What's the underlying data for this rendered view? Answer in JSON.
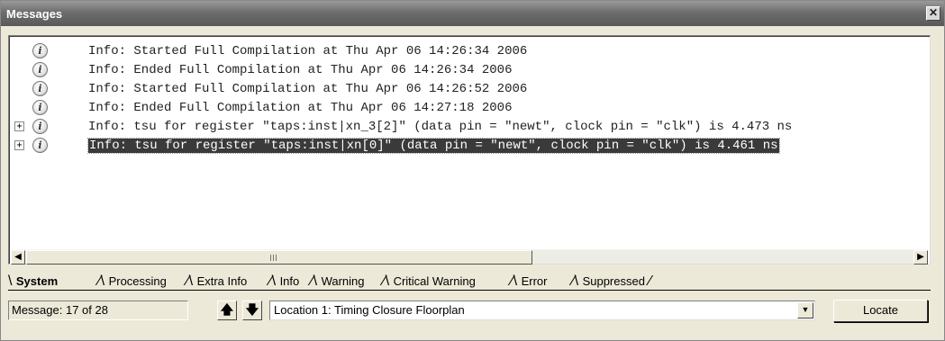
{
  "window": {
    "title": "Messages",
    "close_glyph": "✕"
  },
  "messages": [
    {
      "text": "Info: Started Full Compilation at Thu Apr 06 14:26:34 2006",
      "expandable": false,
      "selected": false
    },
    {
      "text": "Info: Ended Full Compilation at Thu Apr 06 14:26:34 2006",
      "expandable": false,
      "selected": false
    },
    {
      "text": "Info: Started Full Compilation at Thu Apr 06 14:26:52 2006",
      "expandable": false,
      "selected": false
    },
    {
      "text": "Info: Ended Full Compilation at Thu Apr 06 14:27:18 2006",
      "expandable": false,
      "selected": false
    },
    {
      "text": "Info: tsu for register \"taps:inst|xn_3[2]\" (data pin = \"newt\", clock pin = \"clk\") is 4.473 ns",
      "expandable": true,
      "selected": false
    },
    {
      "text": "Info: tsu for register \"taps:inst|xn[0]\" (data pin = \"newt\", clock pin = \"clk\") is 4.461 ns",
      "expandable": true,
      "selected": true
    }
  ],
  "icons": {
    "info": "info-icon",
    "expand": "expand-icon",
    "scroll_left": "scroll-left-icon",
    "scroll_right": "scroll-right-icon",
    "up": "arrow-up-icon",
    "down": "arrow-down-icon",
    "dropdown": "chevron-down-icon"
  },
  "tabs": [
    {
      "label": "System",
      "active": true
    },
    {
      "label": "Processing",
      "active": false
    },
    {
      "label": "Extra Info",
      "active": false
    },
    {
      "label": "Info",
      "active": false
    },
    {
      "label": "Warning",
      "active": false
    },
    {
      "label": "Critical Warning",
      "active": false
    },
    {
      "label": "Error",
      "active": false
    },
    {
      "label": "Suppressed",
      "active": false
    }
  ],
  "status": {
    "message_counter": "Message: 17 of 28"
  },
  "location": {
    "selected": "Location 1: Timing Closure Floorplan"
  },
  "buttons": {
    "locate": "Locate"
  },
  "colors": {
    "titlebar": "#6d6d6d",
    "selection": "#3a3a3a",
    "panel_bg": "#ece9d8"
  }
}
